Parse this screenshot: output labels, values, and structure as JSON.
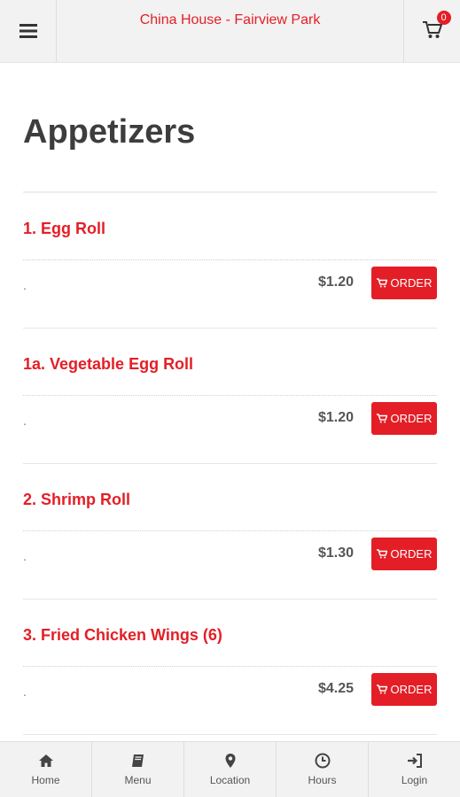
{
  "header": {
    "title": "China House - Fairview Park",
    "cart_count": "0"
  },
  "page": {
    "title": "Appetizers"
  },
  "items": [
    {
      "name": "1. Egg Roll",
      "description": ".",
      "price": "$1.20",
      "order_label": "ORDER"
    },
    {
      "name": "1a. Vegetable Egg Roll",
      "description": ".",
      "price": "$1.20",
      "order_label": "ORDER"
    },
    {
      "name": "2. Shrimp Roll",
      "description": ".",
      "price": "$1.30",
      "order_label": "ORDER"
    },
    {
      "name": "3. Fried Chicken Wings (6)",
      "description": ".",
      "price": "$4.25",
      "order_label": "ORDER"
    }
  ],
  "nav": [
    {
      "label": "Home",
      "icon": "home-icon"
    },
    {
      "label": "Menu",
      "icon": "book-icon"
    },
    {
      "label": "Location",
      "icon": "map-marker-icon"
    },
    {
      "label": "Hours",
      "icon": "clock-icon"
    },
    {
      "label": "Login",
      "icon": "sign-in-icon"
    }
  ],
  "colors": {
    "accent": "#e41e26",
    "bar_background": "#f2f2f2"
  }
}
